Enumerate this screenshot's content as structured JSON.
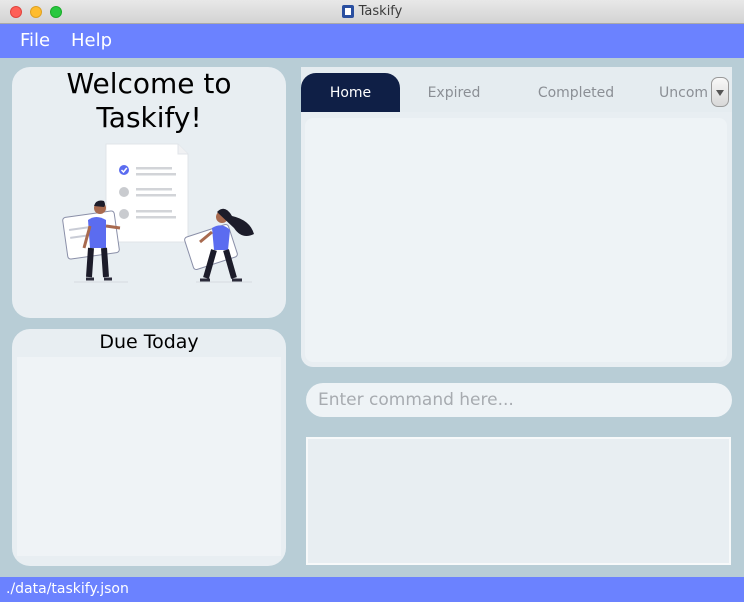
{
  "window": {
    "title": "Taskify"
  },
  "menu": {
    "file": "File",
    "help": "Help"
  },
  "welcome": {
    "title_line1": "Welcome to",
    "title_line2": "Taskify!"
  },
  "due_today": {
    "title": "Due Today"
  },
  "tabs": [
    {
      "label": "Home",
      "selected": true
    },
    {
      "label": "Expired",
      "selected": false
    },
    {
      "label": "Completed",
      "selected": false
    },
    {
      "label": "Uncompleted",
      "selected": false
    }
  ],
  "command": {
    "placeholder": "Enter command here...",
    "value": ""
  },
  "status": {
    "path": "./data/taskify.json"
  },
  "colors": {
    "accent": "#6b82ff",
    "tab_selected": "#0f1f46",
    "background": "#b8cdd6",
    "panel": "#e8eef2"
  },
  "icons": {
    "app": "clipboard-icon",
    "tab_overflow": "chevron-down-icon"
  }
}
